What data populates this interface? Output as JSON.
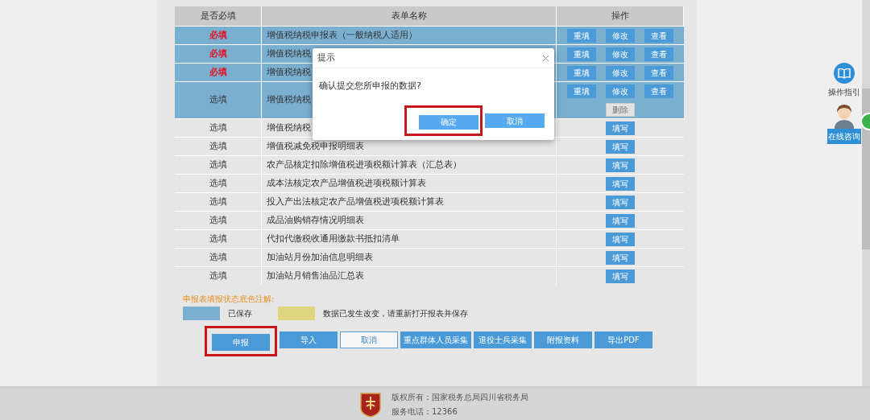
{
  "table": {
    "columns": [
      "是否必填",
      "表单名称",
      "操作"
    ],
    "rows": [
      {
        "requirement": "必填",
        "required": true,
        "name": "增值税纳税申报表（一般纳税人适用）",
        "saved": true,
        "actions": [
          {
            "label": "重填",
            "disabled": false
          },
          {
            "label": "修改",
            "disabled": false
          },
          {
            "label": "查看",
            "disabled": false
          }
        ]
      },
      {
        "requirement": "必填",
        "required": true,
        "name": "增值税纳税",
        "saved": true,
        "actions": [
          {
            "label": "重填",
            "disabled": false
          },
          {
            "label": "修改",
            "disabled": false
          },
          {
            "label": "查看",
            "disabled": false
          }
        ]
      },
      {
        "requirement": "必填",
        "required": true,
        "name": "增值税纳税",
        "saved": true,
        "actions": [
          {
            "label": "重填",
            "disabled": false
          },
          {
            "label": "修改",
            "disabled": false
          },
          {
            "label": "查看",
            "disabled": false
          }
        ]
      },
      {
        "requirement": "选填",
        "required": false,
        "name": "增值税纳税",
        "saved": true,
        "actions": [
          {
            "label": "重填",
            "disabled": false
          },
          {
            "label": "修改",
            "disabled": false
          },
          {
            "label": "查看",
            "disabled": false
          },
          {
            "label": "删除",
            "disabled": true
          }
        ]
      },
      {
        "requirement": "选填",
        "required": false,
        "name": "增值税纳税",
        "saved": false,
        "actions": [
          {
            "label": "填写",
            "disabled": false
          }
        ]
      },
      {
        "requirement": "选填",
        "required": false,
        "name": "增值税减免税申报明细表",
        "saved": false,
        "actions": [
          {
            "label": "填写",
            "disabled": false
          }
        ]
      },
      {
        "requirement": "选填",
        "required": false,
        "name": "农产品核定扣除增值税进项税额计算表（汇总表）",
        "saved": false,
        "actions": [
          {
            "label": "填写",
            "disabled": false
          }
        ]
      },
      {
        "requirement": "选填",
        "required": false,
        "name": "成本法核定农产品增值税进项税额计算表",
        "saved": false,
        "actions": [
          {
            "label": "填写",
            "disabled": false
          }
        ]
      },
      {
        "requirement": "选填",
        "required": false,
        "name": "投入产出法核定农产品增值税进项税额计算表",
        "saved": false,
        "actions": [
          {
            "label": "填写",
            "disabled": false
          }
        ]
      },
      {
        "requirement": "选填",
        "required": false,
        "name": "成品油购销存情况明细表",
        "saved": false,
        "actions": [
          {
            "label": "填写",
            "disabled": false
          }
        ]
      },
      {
        "requirement": "选填",
        "required": false,
        "name": "代扣代缴税收通用缴款书抵扣清单",
        "saved": false,
        "actions": [
          {
            "label": "填写",
            "disabled": false
          }
        ]
      },
      {
        "requirement": "选填",
        "required": false,
        "name": "加油站月份加油信息明细表",
        "saved": false,
        "actions": [
          {
            "label": "填写",
            "disabled": false
          }
        ]
      },
      {
        "requirement": "选填",
        "required": false,
        "name": "加油站月销售油品汇总表",
        "saved": false,
        "actions": [
          {
            "label": "填写",
            "disabled": false
          }
        ]
      }
    ]
  },
  "legend": {
    "title": "申报表填报状态底色注解:",
    "items": [
      {
        "color": "#7aafd0",
        "label": "已保存"
      },
      {
        "color": "#ddd580",
        "label": "数据已发生改变，请重新打开报表并保存"
      }
    ]
  },
  "buttons": [
    {
      "label": "申报",
      "kind": "primary",
      "highlighted": true
    },
    {
      "label": "导入",
      "kind": "primary",
      "highlighted": false
    },
    {
      "label": "取消",
      "kind": "outline",
      "highlighted": false
    },
    {
      "label": "重点群体人员采集",
      "kind": "primary",
      "highlighted": false
    },
    {
      "label": "退役士兵采集",
      "kind": "primary",
      "highlighted": false
    },
    {
      "label": "附报资料",
      "kind": "primary",
      "highlighted": false
    },
    {
      "label": "导出PDF",
      "kind": "primary",
      "highlighted": false
    }
  ],
  "dialog": {
    "title": "提示",
    "message": "确认提交您所申报的数据?",
    "buttons": [
      {
        "label": "确定",
        "highlighted": true
      },
      {
        "label": "取消",
        "highlighted": false
      }
    ]
  },
  "side_widget": {
    "guide_label": "操作指引",
    "consult_label": "在线咨询"
  },
  "footer": {
    "copyright": "版权所有：国家税务总局四川省税务局",
    "phone": "服务电话：12366"
  }
}
